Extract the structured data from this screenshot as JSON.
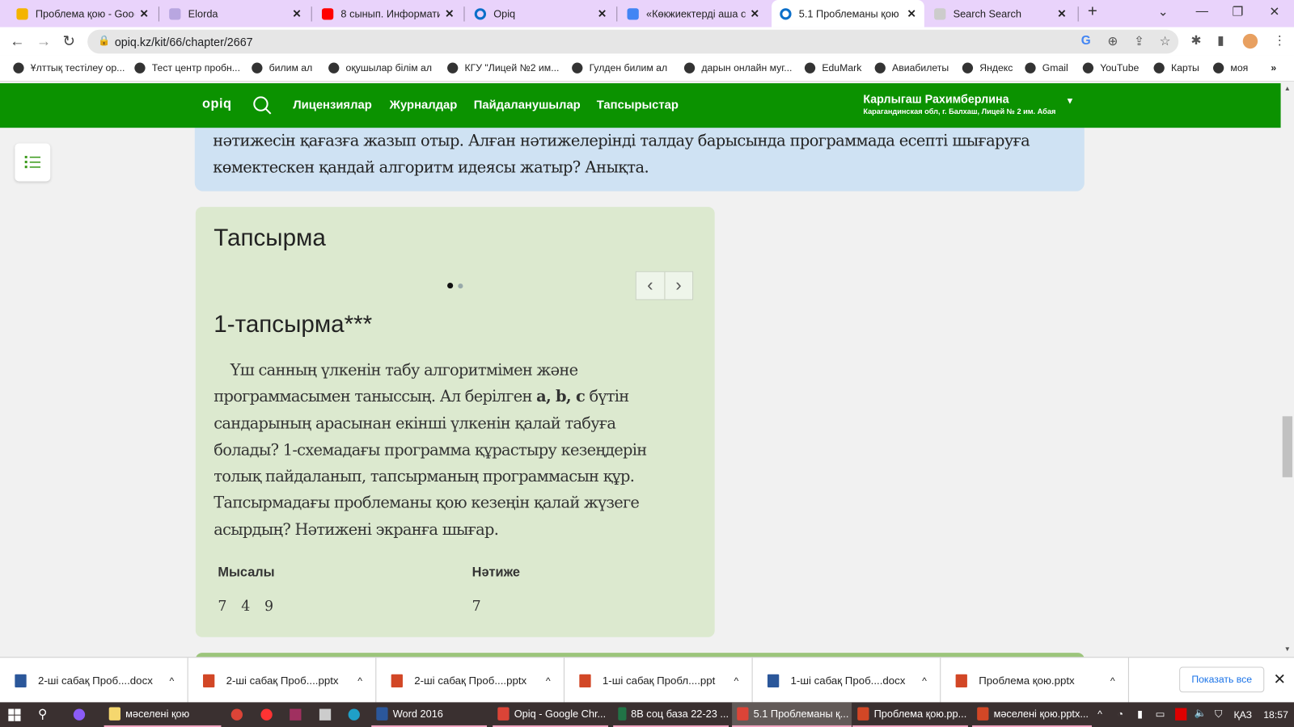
{
  "browser": {
    "tabs": [
      {
        "title": "Проблема қою - Goog",
        "icon": "google-slides-icon",
        "color": "#f4b400"
      },
      {
        "title": "Elorda",
        "icon": "elorda-icon",
        "color": "#b8a6e0"
      },
      {
        "title": "8 сынып. Информатика",
        "icon": "youtube-icon",
        "color": "#ff0000"
      },
      {
        "title": "Opiq",
        "icon": "opiq-icon",
        "color": "#0b6fc9"
      },
      {
        "title": "«Көкжиектерді аша отырып",
        "icon": "google-icon",
        "color": "#4285f4"
      },
      {
        "title": "5.1 Проблеманы қою -",
        "icon": "opiq-icon",
        "color": "#0b6fc9",
        "active": true
      },
      {
        "title": "Search Search",
        "icon": "google-search-icon",
        "color": "#cccccc"
      }
    ],
    "url": "opiq.kz/kit/66/chapter/2667",
    "bookmarks": [
      "Ұлттық тестілеу ор...",
      "Тест центр пробн...",
      "билим ал",
      "оқушылар білім ал",
      "КГУ \"Лицей №2 им...",
      "Гулден билим ал",
      "дарын онлайн муг...",
      "EduMark",
      "Авиабилеты",
      "Яндекс",
      "Gmail",
      "YouTube",
      "Карты",
      "моя"
    ]
  },
  "site": {
    "logo": "opiq",
    "nav": [
      "Лицензиялар",
      "Журналдар",
      "Пайдаланушылар",
      "Тапсырыстар"
    ],
    "user_name": "Карлыгаш Рахимберлина",
    "user_org": "Карагандинская обл, г. Балхаш, Лицей № 2 им. Абая",
    "accent": "#0b9200"
  },
  "content": {
    "intro_line1": "нәтижесін қағазға жазып отыр. Алған нәтижелерінді талдау барысында программада есепті шығаруға",
    "intro_line2": "көмектескен қандай алгоритм идеясы жатыр? Анықта.",
    "card_title": "Тапсырма",
    "slides": {
      "count": 2,
      "current": 1
    },
    "task_title": "1-тапсырма***",
    "task_text_a": "Үш санның үлкенін табу алгоритмімен және программасымен таныссың. Ал берілген ",
    "task_text_bold": "a, b, c",
    "task_text_b": " бүтін сандарының арасынан екінші үлкенін қалай табуға болады? 1-схемадағы программа құрастыру кезеңдерін толық пайдаланып, тапсырманың программасын құр. Тапсырмадағы проблеманы қою кезеңін қалай жүзеге асырдың? Нәтижені экранға шығар.",
    "example_header": "Мысалы",
    "result_header": "Нәтиже",
    "example_values": [
      "7",
      "4",
      "9"
    ],
    "result_value": "7"
  },
  "downloads": {
    "items": [
      {
        "name": "2-ші сабақ Проб....docx",
        "type": "word"
      },
      {
        "name": "2-ші сабақ Проб....pptx",
        "type": "powerpoint"
      },
      {
        "name": "2-ші сабақ Проб....pptx",
        "type": "powerpoint"
      },
      {
        "name": "1-ші сабақ Пробл....ppt",
        "type": "powerpoint"
      },
      {
        "name": "1-ші сабақ Проб....docx",
        "type": "word"
      },
      {
        "name": "Проблема қою.pptx",
        "type": "powerpoint"
      }
    ],
    "show_all": "Показать все"
  },
  "taskbar": {
    "items": [
      {
        "label": "мәселені қою",
        "icon": "folder-icon",
        "color": "#f5d76e"
      },
      {
        "label": "Word 2016",
        "icon": "word-icon",
        "color": "#2b579a"
      },
      {
        "label": "Opiq - Google Chr...",
        "icon": "chrome-icon",
        "color": "#db4437"
      },
      {
        "label": "8В соц база 22-23 ...",
        "icon": "excel-icon",
        "color": "#217346"
      },
      {
        "label": "5.1 Проблеманы қ...",
        "icon": "chrome-icon",
        "color": "#db4437",
        "active": true
      },
      {
        "label": "Проблема қою.pp...",
        "icon": "powerpoint-icon",
        "color": "#d24726"
      },
      {
        "label": "мәселені қою.pptx...",
        "icon": "powerpoint-icon",
        "color": "#d24726"
      }
    ],
    "language": "ҚАЗ",
    "time": "18:57"
  }
}
